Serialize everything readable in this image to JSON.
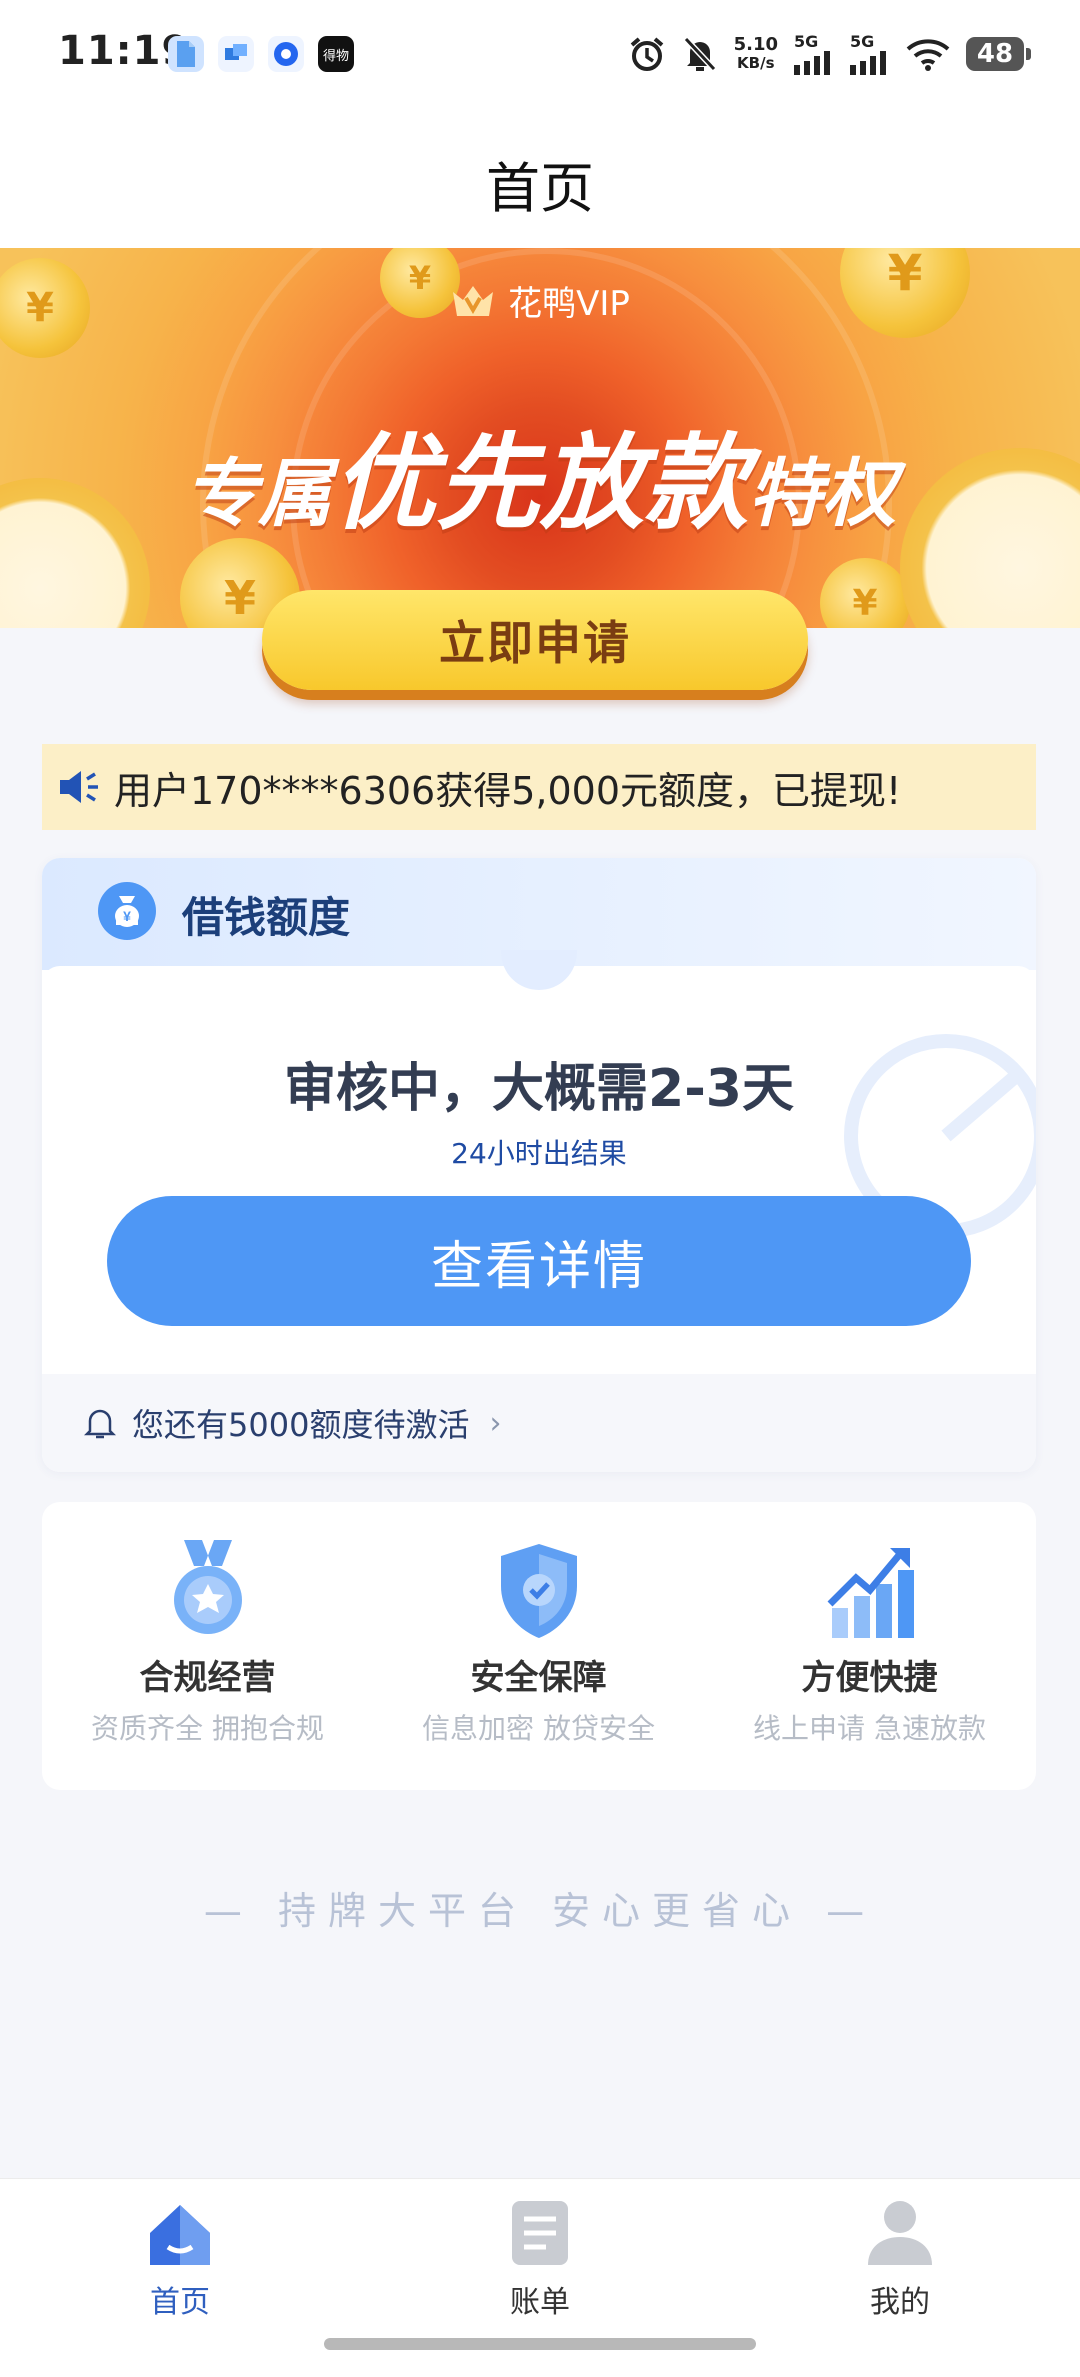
{
  "status_bar": {
    "time": "11:19",
    "net_speed_value": "5.10",
    "net_speed_unit": "KB/s",
    "signal1": "5G",
    "signal2": "5G",
    "battery": "48",
    "app_icons": [
      "app-icon-1",
      "app-icon-2",
      "app-icon-3",
      "app-icon-4"
    ],
    "app_icon4_label": "得物"
  },
  "header": {
    "title": "首页"
  },
  "banner": {
    "vip_label": "花鸭VIP",
    "slogan_prefix": "专属",
    "slogan_main": "优先放款",
    "slogan_suffix": "特权",
    "apply_button": "立即申请"
  },
  "notice": {
    "text": "用户170****6306获得5,000元额度，已提现!"
  },
  "loan_card": {
    "title": "借钱额度",
    "status": "审核中，大概需2-3天",
    "sub_status": "24小时出结果",
    "detail_button": "查看详情",
    "footer_text": "您还有5000额度待激活"
  },
  "features": [
    {
      "title": "合规经营",
      "desc": "资质齐全 拥抱合规",
      "icon": "medal-icon"
    },
    {
      "title": "安全保障",
      "desc": "信息加密 放贷安全",
      "icon": "shield-icon"
    },
    {
      "title": "方便快捷",
      "desc": "线上申请 急速放款",
      "icon": "chart-up-icon"
    }
  ],
  "tagline": "— 持牌大平台 安心更省心 —",
  "tabbar": {
    "items": [
      {
        "label": "首页",
        "icon": "home-icon",
        "active": true
      },
      {
        "label": "账单",
        "icon": "bill-icon",
        "active": false
      },
      {
        "label": "我的",
        "icon": "user-icon",
        "active": false
      }
    ]
  },
  "colors": {
    "primary_blue": "#4e97f5",
    "banner_orange": "#f47a35",
    "apply_yellow": "#f8c82c",
    "notice_bg": "#fcefc7"
  }
}
